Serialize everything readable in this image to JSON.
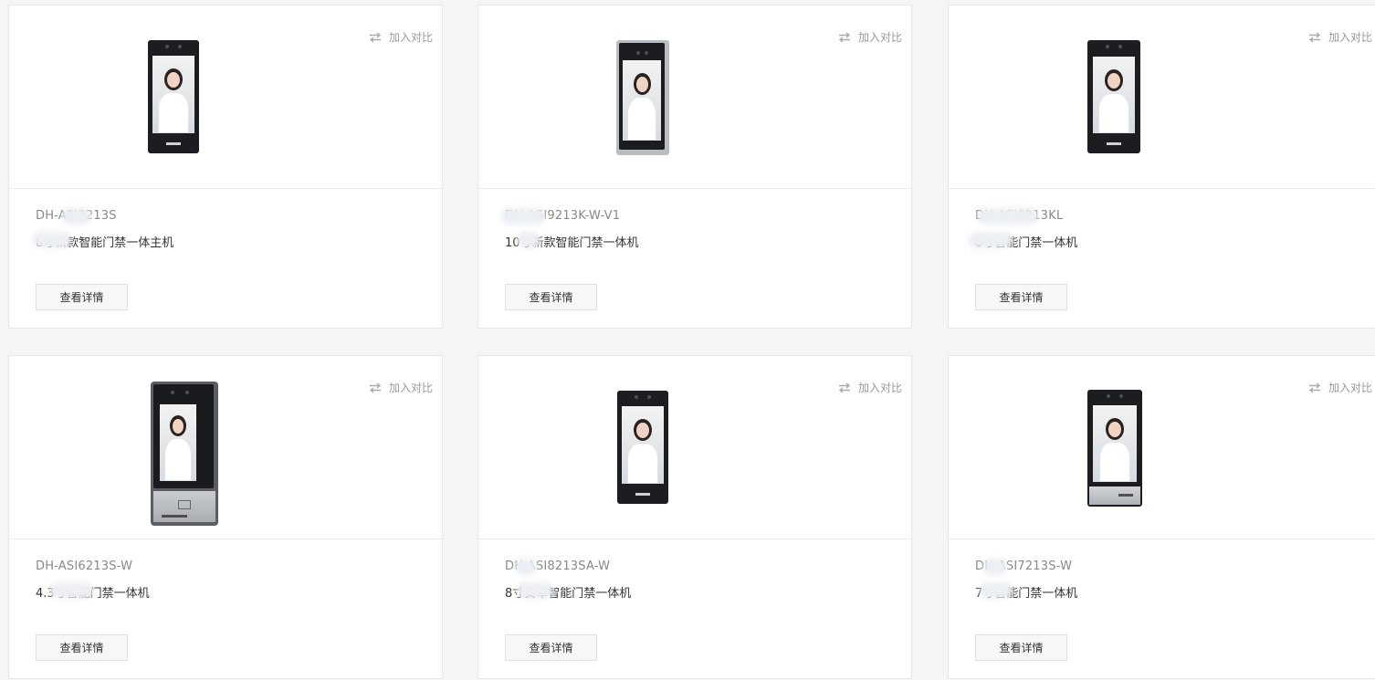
{
  "compare_label": "加入对比",
  "detail_label": "查看详情",
  "products": [
    {
      "model": "DH-ASI8213S",
      "desc": "8寸新款智能门禁一体主机"
    },
    {
      "model": "DH-ASI9213K-W-V1",
      "desc": "10寸新款智能门禁一体机"
    },
    {
      "model": "DH-ASI8213KL",
      "desc": "8寸智能门禁一体机"
    },
    {
      "model": "DH-ASI6213S-W",
      "desc": "4.3寸智能门禁一体机"
    },
    {
      "model": "DH-ASI8213SA-W",
      "desc": "8寸安卓智能门禁一体机"
    },
    {
      "model": "DH-ASI7213S-W",
      "desc": "7寸智能门禁一体机"
    }
  ],
  "icons": {
    "compare": "swap-arrows-icon"
  }
}
